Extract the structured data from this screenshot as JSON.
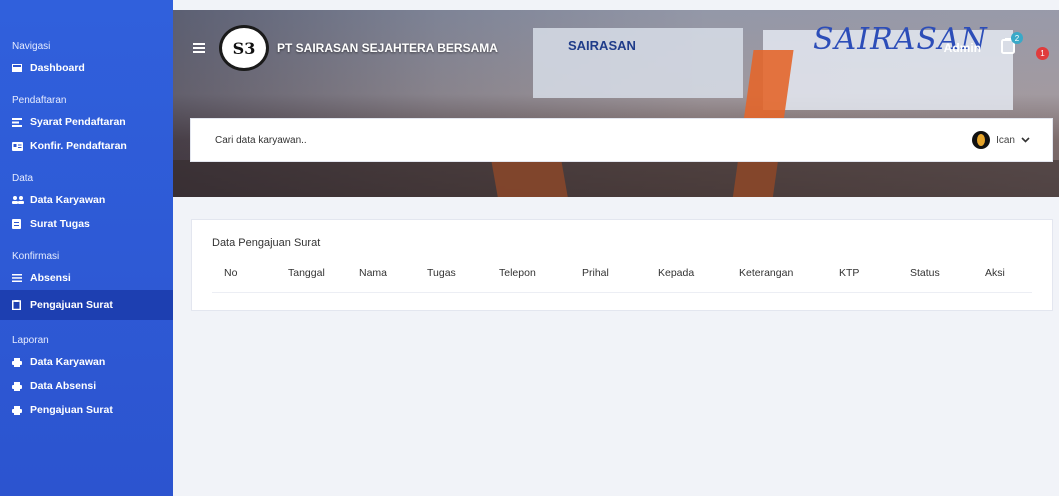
{
  "sidebar": {
    "sections": [
      {
        "title": "Navigasi",
        "items": [
          {
            "label": "Dashboard",
            "icon": "dashboard-icon"
          }
        ]
      },
      {
        "title": "Pendaftaran",
        "items": [
          {
            "label": "Syarat Pendaftaran",
            "icon": "list-icon"
          },
          {
            "label": "Konfir. Pendaftaran",
            "icon": "id-card-icon"
          }
        ]
      },
      {
        "title": "Data",
        "items": [
          {
            "label": "Data Karyawan",
            "icon": "users-icon"
          },
          {
            "label": "Surat Tugas",
            "icon": "document-icon"
          }
        ]
      },
      {
        "title": "Konfirmasi",
        "items": [
          {
            "label": "Absensi",
            "icon": "bars-icon"
          },
          {
            "label": "Pengajuan Surat",
            "icon": "clipboard-icon"
          }
        ]
      },
      {
        "title": "Laporan",
        "items": [
          {
            "label": "Data Karyawan",
            "icon": "printer-icon"
          },
          {
            "label": "Data Absensi",
            "icon": "printer-icon"
          },
          {
            "label": "Pengajuan Surat",
            "icon": "printer-icon"
          }
        ]
      }
    ]
  },
  "header": {
    "logo_text": "S3",
    "company": "PT SAIRASAN SEJAHTERA BERSAMA",
    "banner_sign": "SAIRASAN",
    "banner_script": "SAIRASAN",
    "admin_label": "Admin",
    "doc_badge": "2",
    "alert_badge": "1"
  },
  "search": {
    "placeholder": "Cari data karyawan.."
  },
  "user": {
    "name": "Ican"
  },
  "card": {
    "title": "Data Pengajuan Surat",
    "columns": [
      "No",
      "Tanggal",
      "Nama",
      "Tugas",
      "Telepon",
      "Prihal",
      "Kepada",
      "Keterangan",
      "KTP",
      "Status",
      "Aksi"
    ]
  },
  "colors": {
    "sidebar": "#2c54cf",
    "active": "#1d3fb1",
    "badge_alert": "#e03c3c",
    "badge_info": "#39a9c8"
  }
}
